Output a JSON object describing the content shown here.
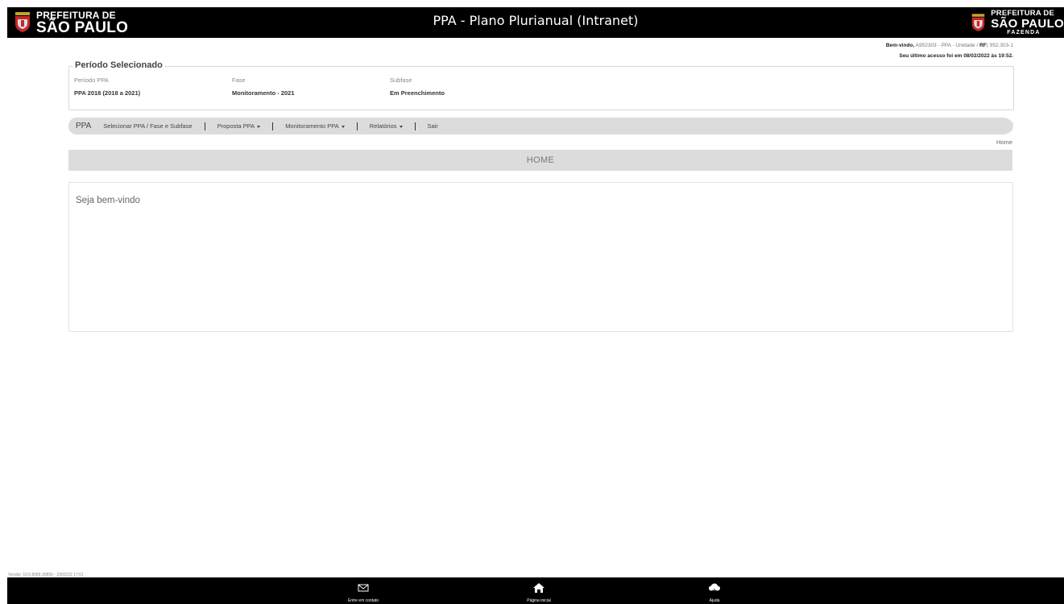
{
  "header": {
    "title": "PPA - Plano Plurianual (Intranet)",
    "logo_left": {
      "line1": "PREFEITURA DE",
      "line2": "SÃO PAULO"
    },
    "logo_right": {
      "line1": "PREFEITURA DE",
      "line2": "SÃO PAULO",
      "line3": "FAZENDA"
    }
  },
  "user": {
    "welcome": "Bem-vindo,",
    "user_id": "A952303 - PPA - Unidade /",
    "rf_label": "RF:",
    "rf_value": "952.303-1",
    "last_access": "Seu último acesso foi em 08/02/2022 às 19:52."
  },
  "period": {
    "legend": "Período Selecionado",
    "fields": [
      {
        "label": "Período PPA",
        "value": "PPA 2018 (2018 a 2021)"
      },
      {
        "label": "Fase",
        "value": "Monitoramento - 2021"
      },
      {
        "label": "Subfase",
        "value": "Em Preenchimento"
      }
    ]
  },
  "menu": {
    "brand": "PPA",
    "items": [
      "Selecionar PPA / Fase e Subfase",
      "Proposta PPA",
      "Monitoramento PPA",
      "Relatórios",
      "Sair"
    ]
  },
  "breadcrumb": "Home",
  "page_title": "HOME",
  "content": {
    "welcome": "Seja bem-vindo"
  },
  "version": "Versão: 10.0.8089.30850 - 23/02/22 17:01",
  "footer": {
    "items": [
      {
        "label": "Entre em contato",
        "icon": "envelope-icon"
      },
      {
        "label": "Página inicial",
        "icon": "home-icon"
      },
      {
        "label": "Ajuda",
        "icon": "help-icon"
      }
    ]
  },
  "colors": {
    "header_bg": "#000000",
    "bar_bg": "#dcdcdc"
  }
}
